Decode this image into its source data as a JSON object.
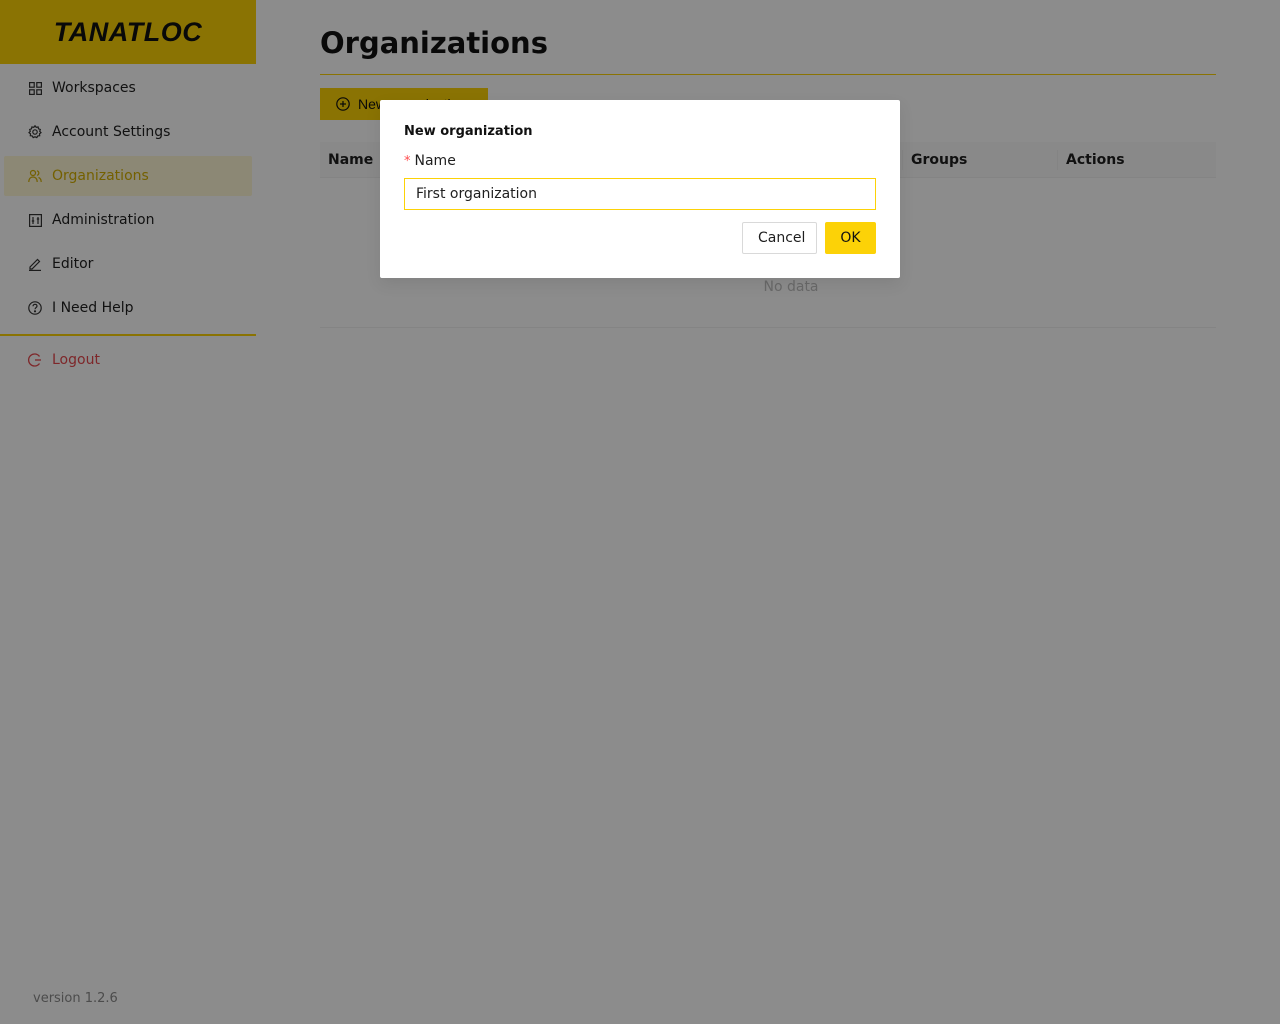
{
  "app": {
    "logo_text": "TANATLOC",
    "version": "version 1.2.6"
  },
  "sidebar": {
    "items": [
      {
        "label": "Workspaces",
        "icon": "grid-icon"
      },
      {
        "label": "Account Settings",
        "icon": "gear-icon"
      },
      {
        "label": "Organizations",
        "icon": "users-icon",
        "active": true
      },
      {
        "label": "Administration",
        "icon": "sliders-icon"
      },
      {
        "label": "Editor",
        "icon": "pencil-icon"
      },
      {
        "label": "I Need Help",
        "icon": "question-icon"
      }
    ],
    "logout_label": "Logout"
  },
  "main": {
    "title": "Organizations",
    "new_button_label": "New organization",
    "table": {
      "columns": [
        "Name",
        "Groups",
        "Actions"
      ],
      "empty_text": "No data"
    }
  },
  "modal": {
    "title": "New organization",
    "field_label": "Name",
    "required_mark": "*",
    "field_value": "First organization",
    "cancel_label": "Cancel",
    "ok_label": "OK"
  },
  "colors": {
    "accent": "#fcd207",
    "logout": "#e5484d",
    "required": "#ff4d4f"
  }
}
